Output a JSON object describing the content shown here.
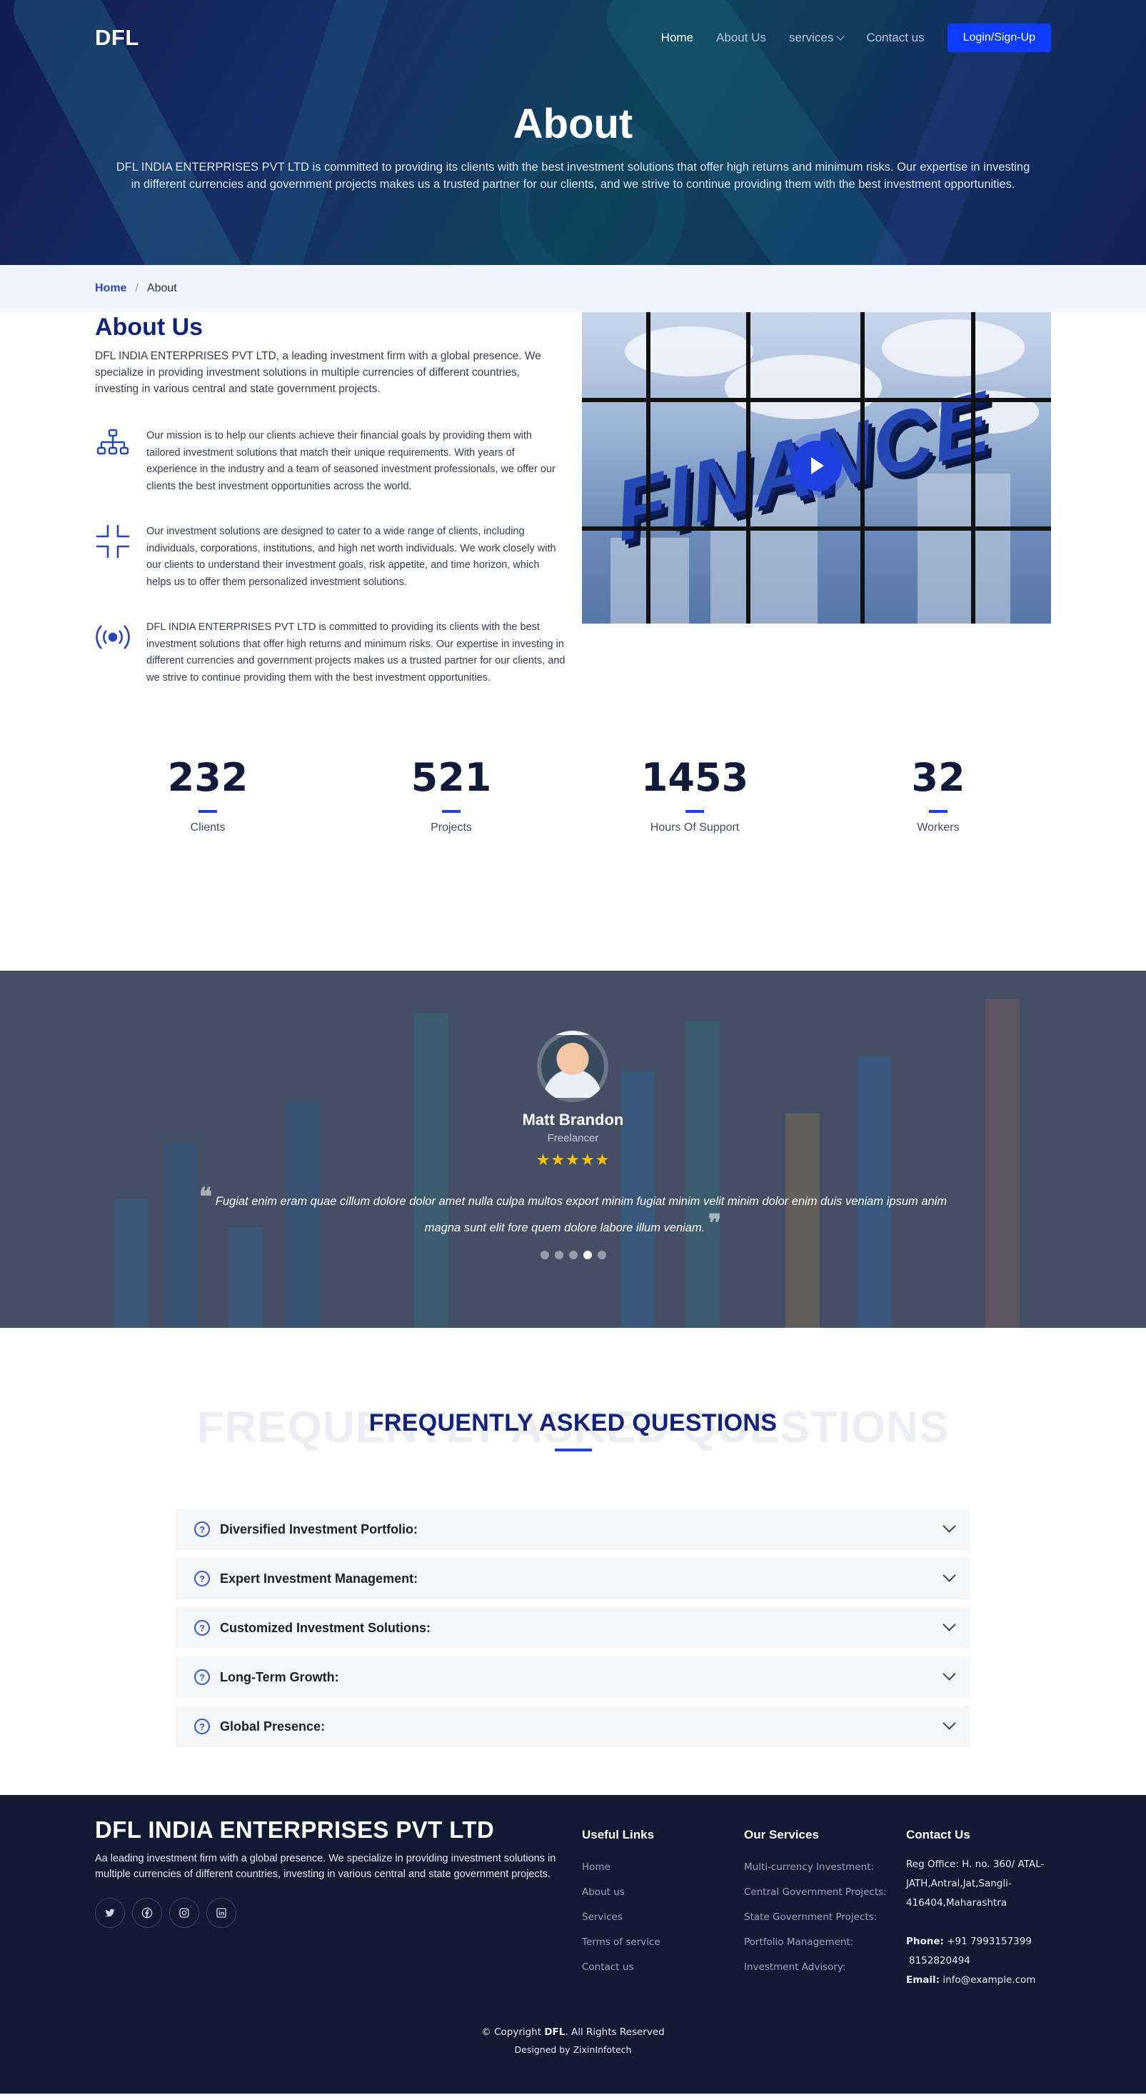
{
  "nav": {
    "logo": "DFL",
    "links": [
      "Home",
      "About Us",
      "services",
      "Contact us"
    ],
    "login": "Login/Sign-Up"
  },
  "hero": {
    "title": "About",
    "text": "DFL INDIA ENTERPRISES PVT LTD is committed to providing its clients with the best investment solutions that offer high returns and minimum risks. Our expertise in investing in different currencies and government projects makes us a trusted partner for our clients, and we strive to continue providing them with the best investment opportunities."
  },
  "breadcrumb": {
    "home": "Home",
    "separator": "/",
    "current": "About"
  },
  "about": {
    "title": "About Us",
    "intro": "DFL INDIA ENTERPRISES PVT LTD, a leading investment firm with a global presence. We specialize in providing investment solutions in multiple currencies of different countries, investing in various central and state government projects.",
    "features": [
      {
        "icon": "sitemap-icon",
        "text": "Our mission is to help our clients achieve their financial goals by providing them with tailored investment solutions that match their unique requirements. With years of experience in the industry and a team of seasoned investment professionals, we offer our clients the best investment opportunities across the world."
      },
      {
        "icon": "fullscreen-exit-icon",
        "text": "Our investment solutions are designed to cater to a wide range of clients, including individuals, corporations, institutions, and high net worth individuals. We work closely with our clients to understand their investment goals, risk appetite, and time horizon, which helps us to offer them personalized investment solutions."
      },
      {
        "icon": "broadcast-icon",
        "text": "DFL INDIA ENTERPRISES PVT LTD is committed to providing its clients with the best investment solutions that offer high returns and minimum risks. Our expertise in investing in different currencies and government projects makes us a trusted partner for our clients, and we strive to continue providing them with the best investment opportunities."
      }
    ],
    "image_word": "FINANCE"
  },
  "stats": [
    {
      "value": "232",
      "label": "Clients"
    },
    {
      "value": "521",
      "label": "Projects"
    },
    {
      "value": "1453",
      "label": "Hours Of Support"
    },
    {
      "value": "32",
      "label": "Workers"
    }
  ],
  "testimonial": {
    "name": "Matt Brandon",
    "role": "Freelancer",
    "stars": "★★★★★",
    "rating": 5,
    "quote": "Fugiat enim eram quae cillum dolore dolor amet nulla culpa multos export minim fugiat minim velit minim dolor enim duis veniam ipsum anim magna sunt elit fore quem dolore labore illum veniam.",
    "open_quote": "❝",
    "close_quote": "❞",
    "dots": 5,
    "active_dot": 3
  },
  "faq": {
    "ghost": "FREQUENTLY ASKED QUESTIONS",
    "title": "FREQUENTLY ASKED QUESTIONS",
    "items": [
      "Diversified Investment Portfolio:",
      "Expert Investment Management:",
      "Customized Investment Solutions:",
      "Long-Term Growth:",
      "Global Presence:"
    ],
    "question_mark": "?"
  },
  "footer": {
    "name": "DFL INDIA ENTERPRISES PVT LTD",
    "desc": "Aa leading investment firm with a global presence. We specialize in providing investment solutions in multiple currencies of different countries, investing in various central and state government projects.",
    "socials": [
      "twitter-icon",
      "facebook-icon",
      "instagram-icon",
      "linkedin-icon"
    ],
    "useful_title": "Useful Links",
    "useful_links": [
      "Home",
      "About us",
      "Services",
      "Terms of service",
      "Contact us"
    ],
    "services_title": "Our Services",
    "services": [
      "Multi-currency Investment:",
      "Central Government Projects:",
      "State Government Projects:",
      "Portfolio Management:",
      "Investment Advisory:"
    ],
    "contact_title": "Contact Us",
    "address": "Reg Office: H. no. 360/ ATAL-JATH,Antral,Jat,Sangli-416404,Maharashtra",
    "phone_label": "Phone:",
    "phone1": "+91 7993157399",
    "phone2": "8152820494",
    "email_label": "Email:",
    "email": "info@example.com",
    "copyright_pre": "© Copyright",
    "copyright_brand": "DFL",
    "copyright_post": ". All Rights Reserved",
    "designed": "Designed by ZixinInfotech"
  }
}
